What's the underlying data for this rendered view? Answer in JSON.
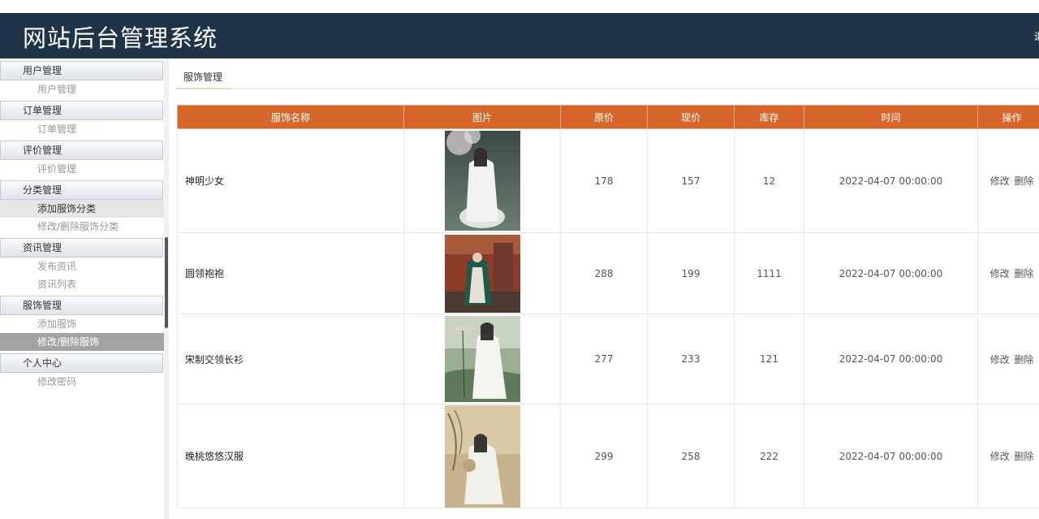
{
  "app": {
    "title": "网站后台管理系统",
    "edge_text": "退"
  },
  "sidebar": {
    "groups": [
      {
        "label": "用户管理",
        "items": [
          {
            "label": "用户管理",
            "state": "normal"
          }
        ]
      },
      {
        "label": "订单管理",
        "items": [
          {
            "label": "订单管理",
            "state": "normal"
          }
        ]
      },
      {
        "label": "评价管理",
        "items": [
          {
            "label": "评价管理",
            "state": "normal"
          }
        ]
      },
      {
        "label": "分类管理",
        "items": [
          {
            "label": "添加服饰分类",
            "state": "soft"
          },
          {
            "label": "修改/删除服饰分类",
            "state": "normal"
          }
        ]
      },
      {
        "label": "资讯管理",
        "items": [
          {
            "label": "发布资讯",
            "state": "normal"
          },
          {
            "label": "资讯列表",
            "state": "normal"
          }
        ]
      },
      {
        "label": "服饰管理",
        "items": [
          {
            "label": "添加服饰",
            "state": "normal"
          },
          {
            "label": "修改/删除服饰",
            "state": "active"
          }
        ]
      },
      {
        "label": "个人中心",
        "items": [
          {
            "label": "修改密码",
            "state": "normal"
          }
        ]
      }
    ]
  },
  "tab": {
    "label": "服饰管理"
  },
  "table": {
    "headers": [
      "服饰名称",
      "图片",
      "原价",
      "现价",
      "库存",
      "时间",
      "操作"
    ],
    "edit_label": "修改",
    "delete_label": "删除",
    "rows": [
      {
        "name": "神明少女",
        "orig_price": "178",
        "price": "157",
        "stock": "12",
        "time": "2022-04-07 00:00:00"
      },
      {
        "name": "圆领袍袍",
        "orig_price": "288",
        "price": "199",
        "stock": "1111",
        "time": "2022-04-07 00:00:00"
      },
      {
        "name": "宋制交领长衫",
        "orig_price": "277",
        "price": "233",
        "stock": "121",
        "time": "2022-04-07 00:00:00"
      },
      {
        "name": "晚桃悠悠汉服",
        "orig_price": "299",
        "price": "258",
        "stock": "222",
        "time": "2022-04-07 00:00:00"
      }
    ]
  },
  "colors": {
    "header_bg": "#1f3448",
    "table_head": "#d7662b",
    "active_item": "#a3a3a3"
  }
}
